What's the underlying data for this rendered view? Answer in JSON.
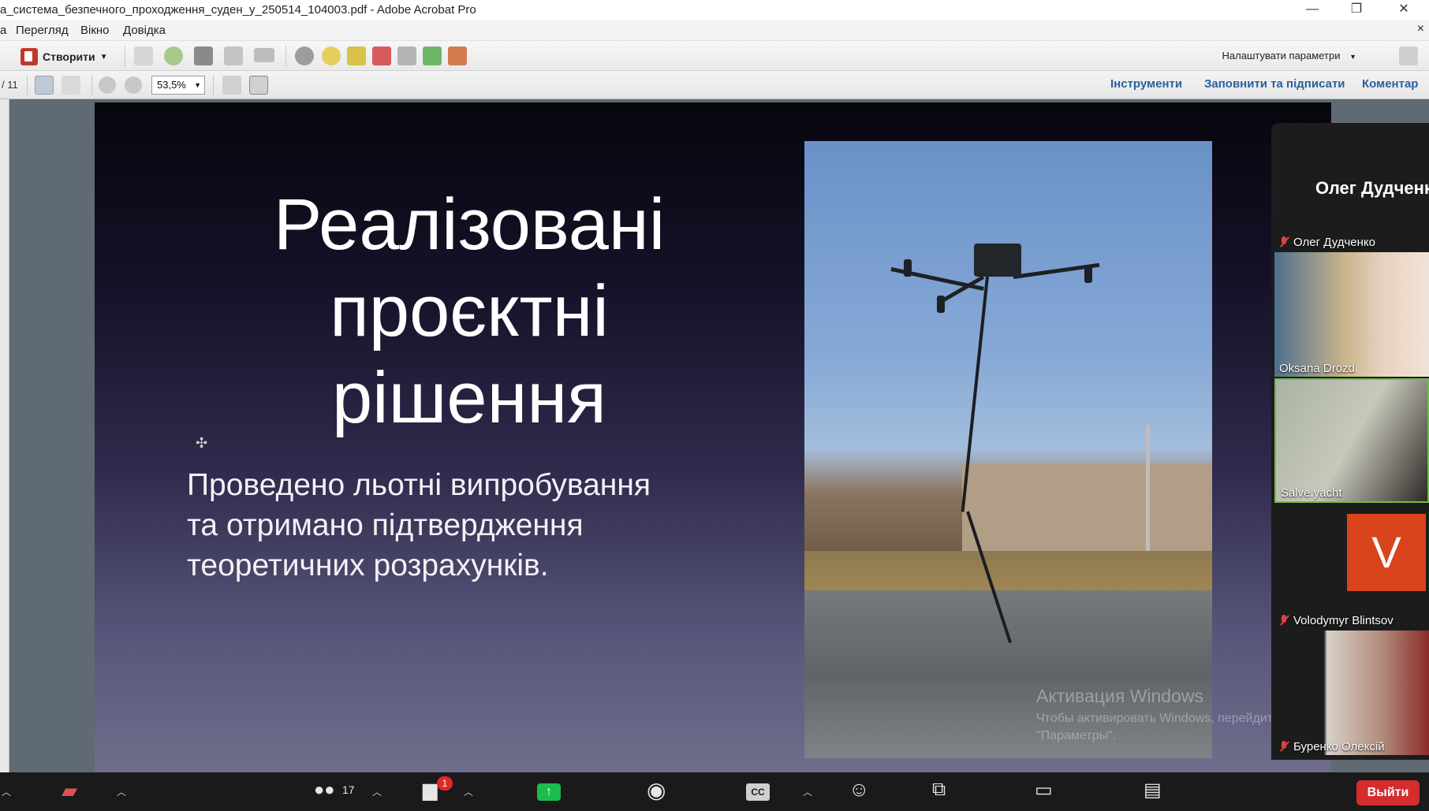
{
  "window": {
    "title": "а_система_безпечного_проходження_суден_у_250514_104003.pdf - Adobe Acrobat Pro",
    "minimize": "—",
    "restore": "❐",
    "close": "✕"
  },
  "menu": {
    "items": [
      "а",
      "Перегляд",
      "Вікно",
      "Довідка"
    ],
    "close_doc": "×"
  },
  "toolbar": {
    "create_label": "Створити",
    "settings_label": "Налаштувати параметри",
    "page_indicator": "/ 11",
    "zoom_value": "53,5%",
    "tabs": [
      "Інструменти",
      "Заповнити та підписати",
      "Коментар"
    ]
  },
  "slide": {
    "title_lines": [
      "Реалізовані",
      "проєктні",
      "рішення"
    ],
    "body_lines": [
      "Проведено льотні випробування",
      "та отримано підтвердження",
      "теоретичних розрахунків."
    ]
  },
  "watermark": {
    "line1": "Активация Windows",
    "line2": "Чтобы активировать Windows, перейдите в раздел",
    "line3": "\"Параметры\"."
  },
  "participants": {
    "active_speaker": "Олег Дудченко",
    "tiles": [
      {
        "name": "Олег Дудченко",
        "muted": true
      },
      {
        "name": "Oksana Drozd",
        "muted": false
      },
      {
        "name": "Salve.yacht",
        "muted": false
      },
      {
        "name": "Volodymyr Blintsov",
        "muted": true,
        "avatar_letter": "V"
      },
      {
        "name": "Буренко Олексій",
        "muted": true
      }
    ]
  },
  "zoombar": {
    "participants_count": "17",
    "chat_badge": "1",
    "cc_label": "CC",
    "leave_label": "Выйти"
  },
  "colors": {
    "acrobat_link": "#2b5f9e",
    "share_green": "#1bbd4b",
    "leave_red": "#d52d2d",
    "avatar_orange": "#d9441c",
    "muted_red": "#e04141"
  }
}
